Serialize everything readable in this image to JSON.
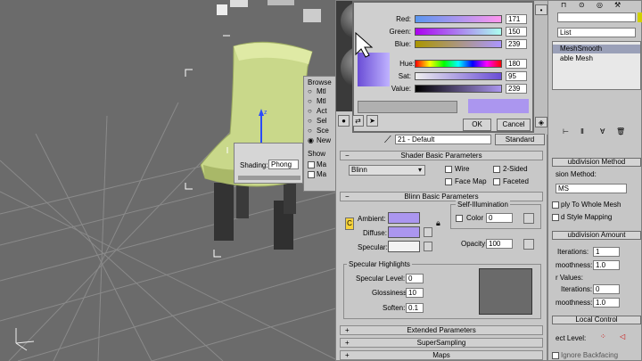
{
  "color_selector": {
    "labels": [
      "Red:",
      "Green:",
      "Blue:",
      "Hue:",
      "Sat:",
      "Value:"
    ],
    "values": [
      "171",
      "150",
      "239",
      "180",
      "95",
      "239"
    ],
    "ok": "OK",
    "cancel": "Cancel"
  },
  "browser_panel": {
    "title": "Browse",
    "options": [
      "Mtl",
      "Mtl",
      "Act",
      "Sel",
      "Sce",
      "New"
    ],
    "show_label": "Show",
    "show_options": [
      "Ma",
      "Ma"
    ]
  },
  "shading_tooltip": {
    "label": "Shading:",
    "value": "Phong"
  },
  "material_editor": {
    "material_name": "21 - Default",
    "type_button": "Standard",
    "shader_basic": {
      "title": "Shader Basic Parameters",
      "shader": "Blinn",
      "wire": "Wire",
      "two_sided": "2-Sided",
      "face_map": "Face Map",
      "faceted": "Faceted"
    },
    "blinn_basic": {
      "title": "Blinn Basic Parameters",
      "self_illum_group": "Self-Illumination",
      "ambient": "Ambient:",
      "diffuse": "Diffuse:",
      "specular": "Specular:",
      "color_label": "Color",
      "color_value": "0",
      "opacity_label": "Opacity:",
      "opacity_value": "100",
      "ambient_color": "#ab96ef",
      "diffuse_color": "#ab96ef",
      "specular_color": "#f2f2f2",
      "lock_letter": "C"
    },
    "specular_highlights": {
      "title": "Specular Highlights",
      "level_label": "Specular Level:",
      "level_value": "0",
      "gloss_label": "Glossiness:",
      "gloss_value": "10",
      "soften_label": "Soften:",
      "soften_value": "0.1"
    },
    "rollouts": [
      "Extended Parameters",
      "SuperSampling",
      "Maps"
    ]
  },
  "command_panel": {
    "list_value": "List",
    "stack_items": [
      "MeshSmooth",
      "able Mesh"
    ],
    "subdivision_method_title": "ubdivision Method",
    "subdivision_method_label": "sion Method:",
    "subdivision_method_value": "MS",
    "apply_whole_mesh": "ply To Whole Mesh",
    "old_style_mapping": "d Style Mapping",
    "subdivision_amount_title": "ubdivision Amount",
    "iterations_label": "Iterations:",
    "iterations_value": "1",
    "smoothness_label": "moothness:",
    "smoothness_value": "1.0",
    "render_values_label": "r Values:",
    "render_iterations_label": "Iterations:",
    "render_iterations_value": "0",
    "render_smoothness_label": "moothness:",
    "render_smoothness_value": "1.0",
    "local_control_title": "Local Control",
    "object_level_label": "ect Level:",
    "ignore_backfacing": "Ignore Backfacing"
  }
}
